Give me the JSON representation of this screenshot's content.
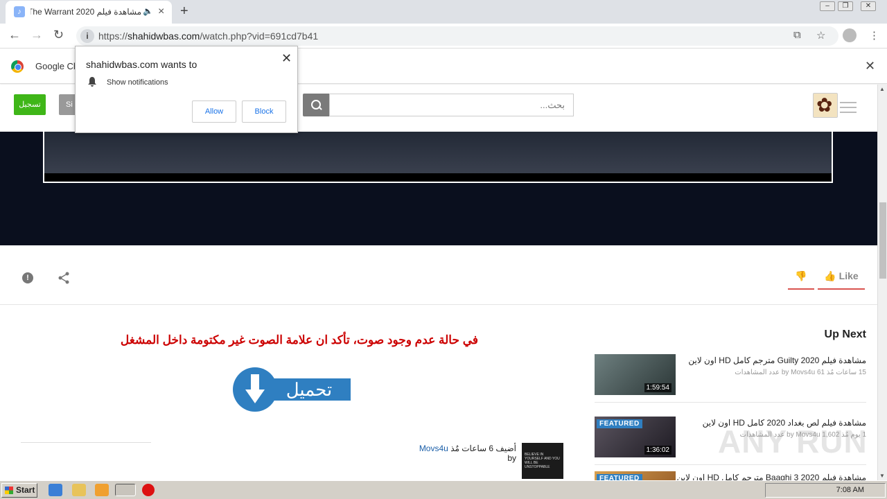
{
  "browser": {
    "tab_title": "مشاهدة فيلم The Warrant 2020",
    "url_prefix": "https://",
    "url_domain": "shahidwbas.com",
    "url_path": "/watch.php?vid=691cd7b41",
    "infobar_text": "Google Ch"
  },
  "popup": {
    "title": "shahidwbas.com wants to",
    "permission": "Show notifications",
    "allow_label": "Allow",
    "block_label": "Block"
  },
  "header": {
    "register_label": "تسجيل",
    "signin_label": "Si",
    "search_placeholder": "بحث..."
  },
  "actions": {
    "like_label": "Like"
  },
  "main": {
    "notice": "في حالة عدم وجود صوت، تأكد ان علامة الصوت غير مكتومة داخل المشغل",
    "download_label": "تحميل",
    "uploader_prefix": "أضيف 6 ساعات مٌذ",
    "uploader_by": "by",
    "uploader_name": "Movs4u",
    "thumb_text": "BELIEVE IN YOURSELF AND YOU WILL BE UNSTOPPABLE"
  },
  "upnext": {
    "title": "Up Next",
    "items": [
      {
        "title": "مشاهدة فيلم Guilty 2020 مترجم كامل HD اون لاين",
        "meta": "15 ساعات مٌذ by Movs4u 61 عدد المشاهدات",
        "duration": "1:59:54",
        "featured": ""
      },
      {
        "title": "مشاهدة فيلم لص بغداد 2020 كامل HD اون لاين",
        "meta": "1 يوم مٌذ by Movs4u 1,602 عدد المشاهدات",
        "duration": "1:36:02",
        "featured": "FEATURED"
      },
      {
        "title": "مشاهدة فيلم Baaghi 3 2020 مترجم كامل HD اون لاين",
        "meta": "",
        "duration": "",
        "featured": "FEATURED"
      }
    ]
  },
  "watermark": "ANY RUN",
  "taskbar": {
    "start_label": "Start",
    "clock": "7:08 AM"
  }
}
